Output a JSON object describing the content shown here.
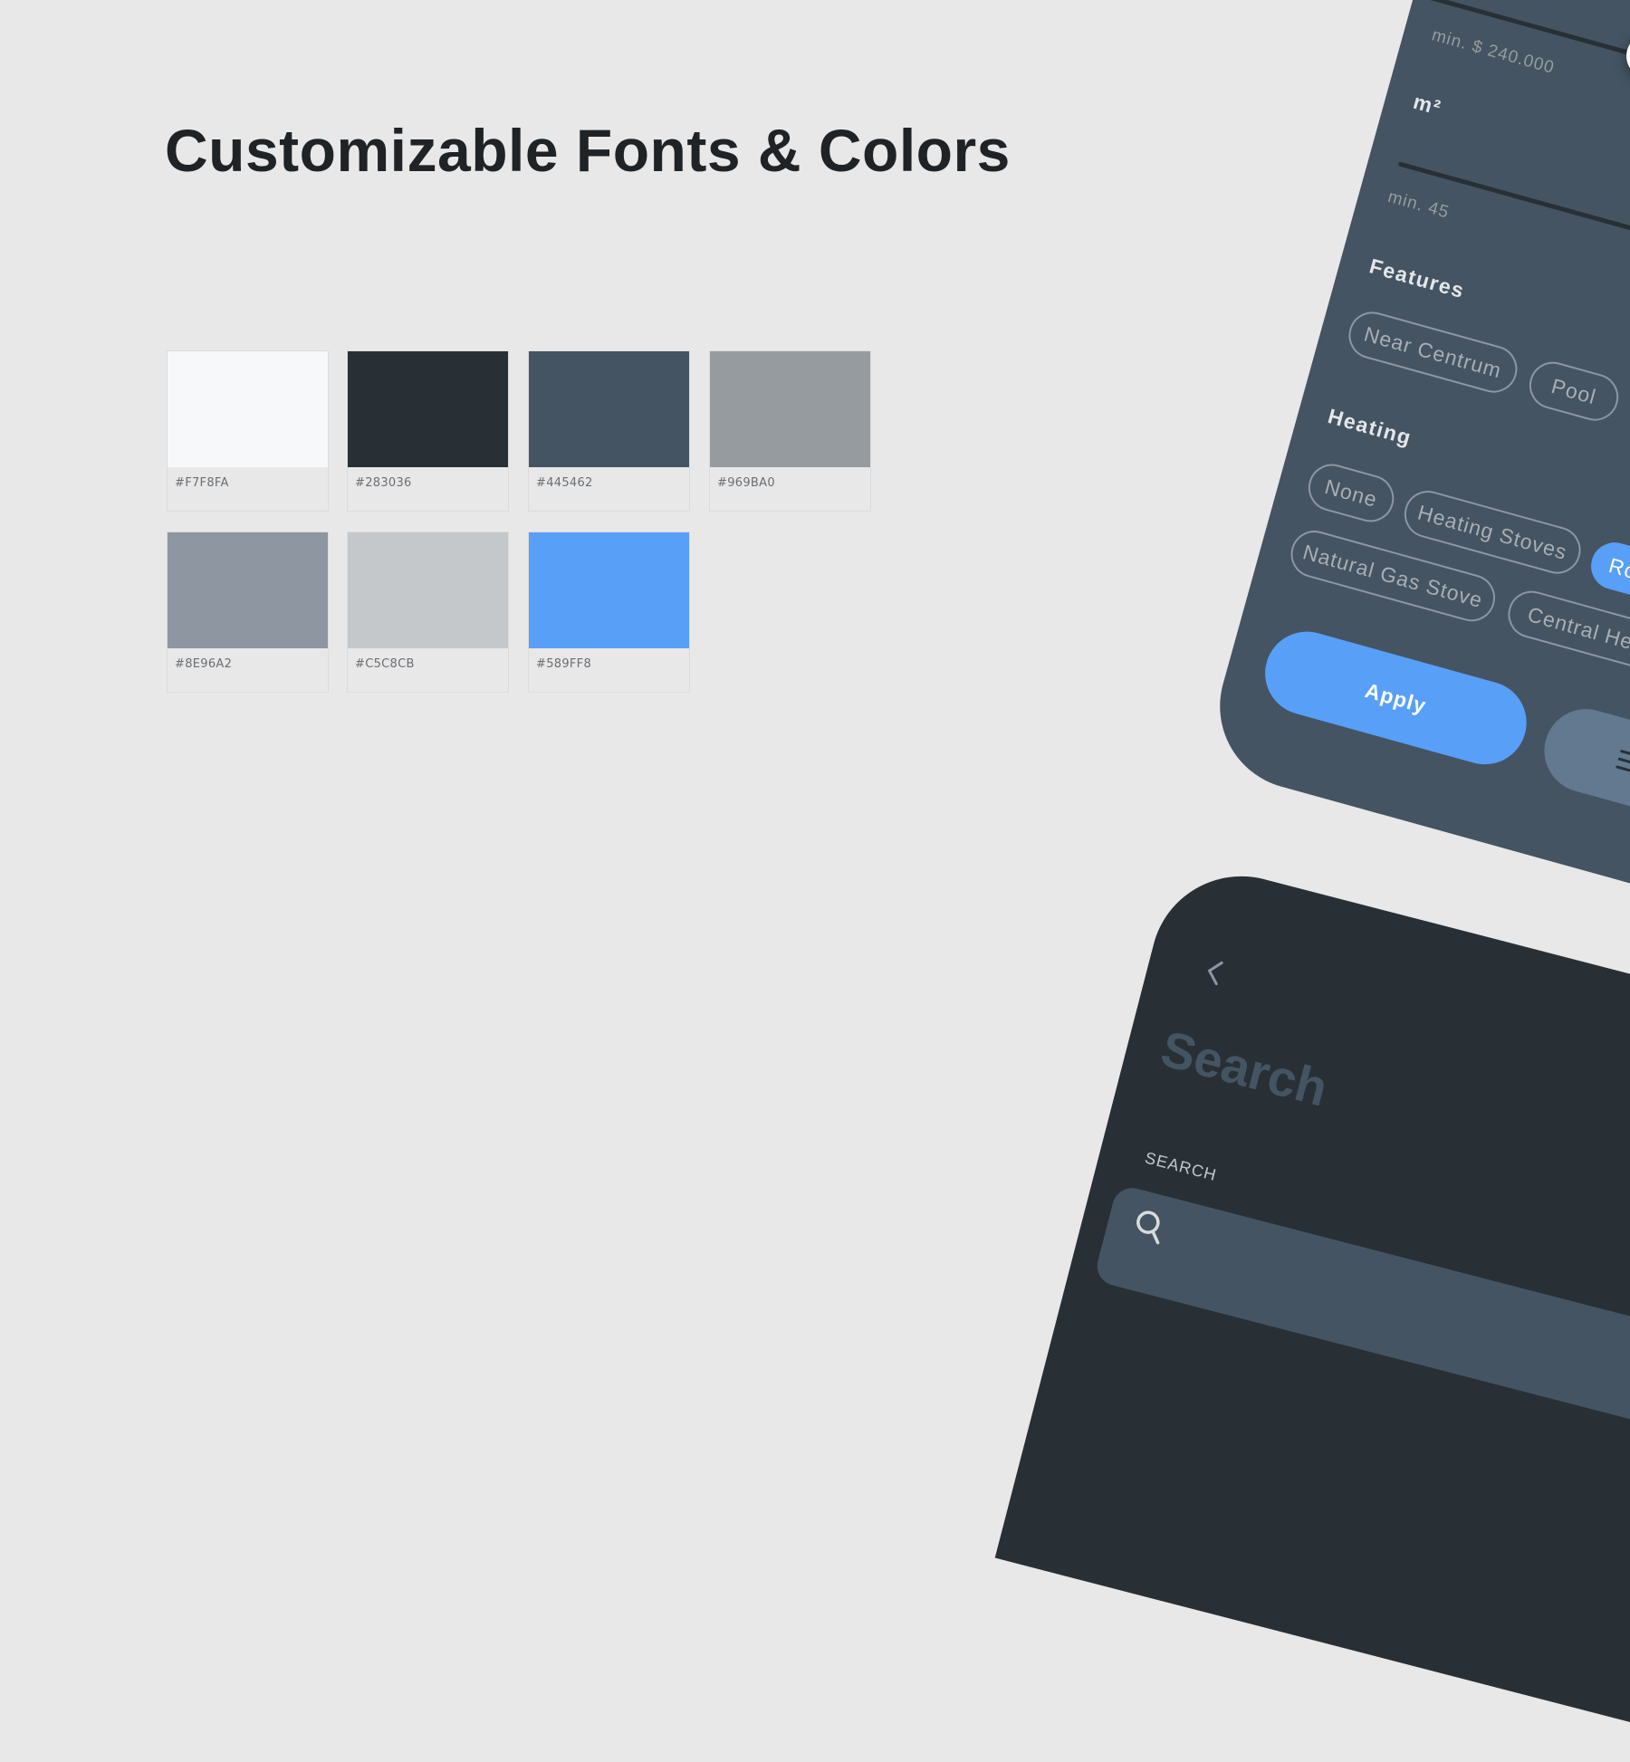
{
  "heading": "Customizable Fonts & Colors",
  "palette": [
    {
      "code": "#F7F8FA",
      "color": "#F7F8FA"
    },
    {
      "code": "#283036",
      "color": "#283036"
    },
    {
      "code": "#445462",
      "color": "#445462"
    },
    {
      "code": "#969BA0",
      "color": "#969BA0"
    },
    {
      "code": "#8E96A2",
      "color": "#8E96A2"
    },
    {
      "code": "#C5C8CB",
      "color": "#C5C8CB"
    },
    {
      "code": "#589FF8",
      "color": "#589FF8"
    }
  ],
  "filter_screen": {
    "price_min": "min. $ 240.000",
    "area_label": "m²",
    "area_min": "min. 45",
    "features_label": "Features",
    "features": [
      "Near Centrum",
      "Pool"
    ],
    "heating_label": "Heating",
    "heating_options": [
      "None",
      "Heating Stoves",
      "Ro",
      "Natural Gas Stove",
      "Central Hea"
    ],
    "heating_selected": "Ro",
    "apply_label": "Apply",
    "filter_icon": "sort-filter-icon"
  },
  "search_screen": {
    "back_icon": "chevron-left-icon",
    "title": "Search",
    "field_label": "SEARCH",
    "search_icon": "search-icon"
  }
}
